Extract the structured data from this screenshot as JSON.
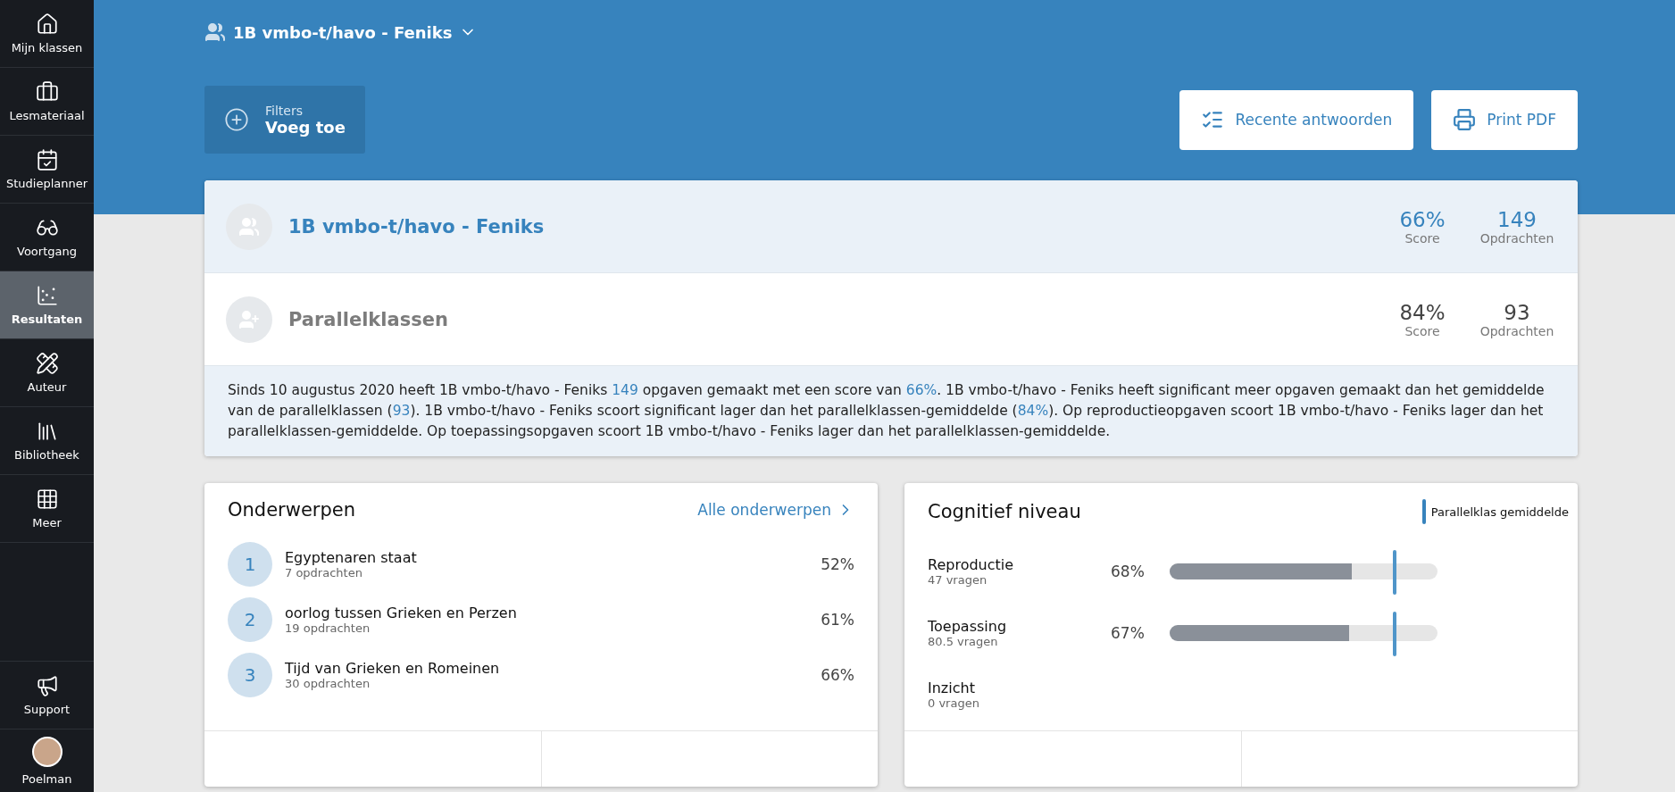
{
  "sidebar": {
    "items": [
      {
        "label": "Mijn klassen",
        "selected": false
      },
      {
        "label": "Lesmateriaal",
        "selected": false
      },
      {
        "label": "Studieplanner",
        "selected": false
      },
      {
        "label": "Voortgang",
        "selected": false
      },
      {
        "label": "Resultaten",
        "selected": true
      },
      {
        "label": "Auteur",
        "selected": false
      },
      {
        "label": "Bibliotheek",
        "selected": false
      },
      {
        "label": "Meer",
        "selected": false
      }
    ],
    "support": "Support",
    "user": "Poelman"
  },
  "header": {
    "class_selector": "1B vmbo-t/havo - Feniks",
    "filters": {
      "label": "Filters",
      "action": "Voeg toe"
    },
    "buttons": [
      "Recente antwoorden",
      "Print PDF"
    ]
  },
  "comparison": {
    "rows": [
      {
        "name": "1B vmbo-t/havo - Feniks",
        "kind": "class",
        "score": "66%",
        "score_label": "Score",
        "count": "149",
        "count_label": "Opdrachten"
      },
      {
        "name": "Parallelklassen",
        "kind": "parallel",
        "score": "84%",
        "score_label": "Score",
        "count": "93",
        "count_label": "Opdrachten"
      }
    ],
    "summary": [
      {
        "text": "Sinds 10 augustus 2020 heeft 1B vmbo-t/havo - Feniks ",
        "highlight": false
      },
      {
        "text": "149",
        "highlight": true
      },
      {
        "text": " opgaven gemaakt met een score van ",
        "highlight": false
      },
      {
        "text": "66%",
        "highlight": true
      },
      {
        "text": ". 1B vmbo-t/havo - Feniks heeft significant meer opgaven gemaakt dan het gemiddelde van de parallelklassen (",
        "highlight": false
      },
      {
        "text": "93",
        "highlight": true
      },
      {
        "text": "). 1B vmbo-t/havo - Feniks scoort significant lager dan het parallelklassen-gemiddelde (",
        "highlight": false
      },
      {
        "text": "84%",
        "highlight": true
      },
      {
        "text": "). Op reproductieopgaven scoort 1B vmbo-t/havo - Feniks lager dan het parallelklassen-gemiddelde. Op toepassingsopgaven scoort 1B vmbo-t/havo - Feniks lager dan het parallelklassen-gemiddelde.",
        "highlight": false
      }
    ]
  },
  "topics": {
    "title": "Onderwerpen",
    "link": "Alle onderwerpen",
    "items": [
      {
        "number": "1",
        "name": "Egyptenaren staat",
        "count": "7 opdrachten",
        "score": "52%"
      },
      {
        "number": "2",
        "name": "oorlog tussen Grieken en Perzen",
        "count": "19 opdrachten",
        "score": "61%"
      },
      {
        "number": "3",
        "name": "Tijd van Grieken en Romeinen",
        "count": "30 opdrachten",
        "score": "66%"
      }
    ]
  },
  "cognitive": {
    "title": "Cognitief niveau",
    "legend": "Parallelklas gemiddelde",
    "items": [
      {
        "name": "Reproductie",
        "count": "47 vragen",
        "kind": "bar",
        "score": "68%",
        "level": 0.68,
        "average": {
          "level": 0.84
        }
      },
      {
        "name": "Toepassing",
        "count": "80.5 vragen",
        "kind": "bar",
        "score": "67%",
        "level": 0.67,
        "average": {
          "level": 0.84
        }
      },
      {
        "name": "Inzicht",
        "count": "0 vragen",
        "kind": "empty"
      }
    ]
  }
}
